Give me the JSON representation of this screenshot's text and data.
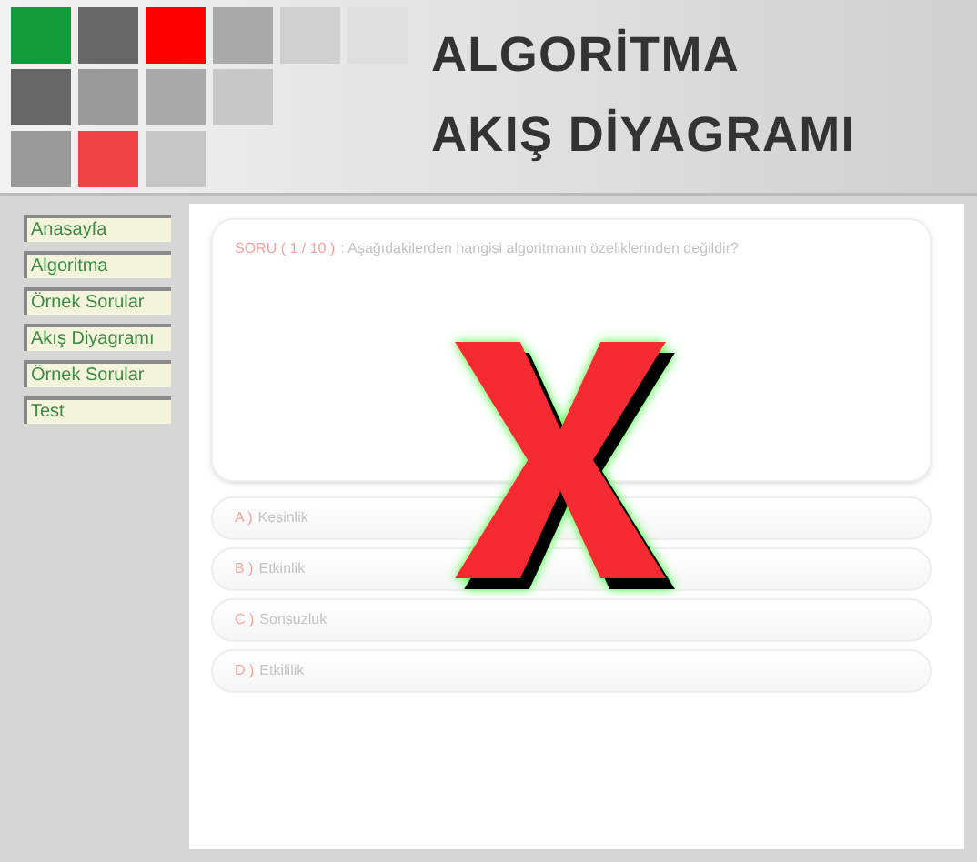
{
  "header": {
    "title_lines": [
      "ALGORİTMA",
      "AKIŞ DİYAGRAMI"
    ]
  },
  "sidebar": {
    "items": [
      {
        "label": "Anasayfa"
      },
      {
        "label": "Algoritma"
      },
      {
        "label": "Örnek Sorular"
      },
      {
        "label": "Akış Diyagramı"
      },
      {
        "label": "Örnek Sorular"
      },
      {
        "label": "Test"
      }
    ]
  },
  "question": {
    "number": "SORU ( 1 / 10 )",
    "text": ": Aşağıdakilerden hangisi algoritmanın özeliklerinden değildir?"
  },
  "options": [
    {
      "letter": "A )",
      "text": "Kesinlik"
    },
    {
      "letter": "B )",
      "text": "Etkinlik"
    },
    {
      "letter": "C )",
      "text": "Sonsuzluk"
    },
    {
      "letter": "D )",
      "text": "Etkililik"
    }
  ],
  "feedback": {
    "kind": "wrong"
  }
}
